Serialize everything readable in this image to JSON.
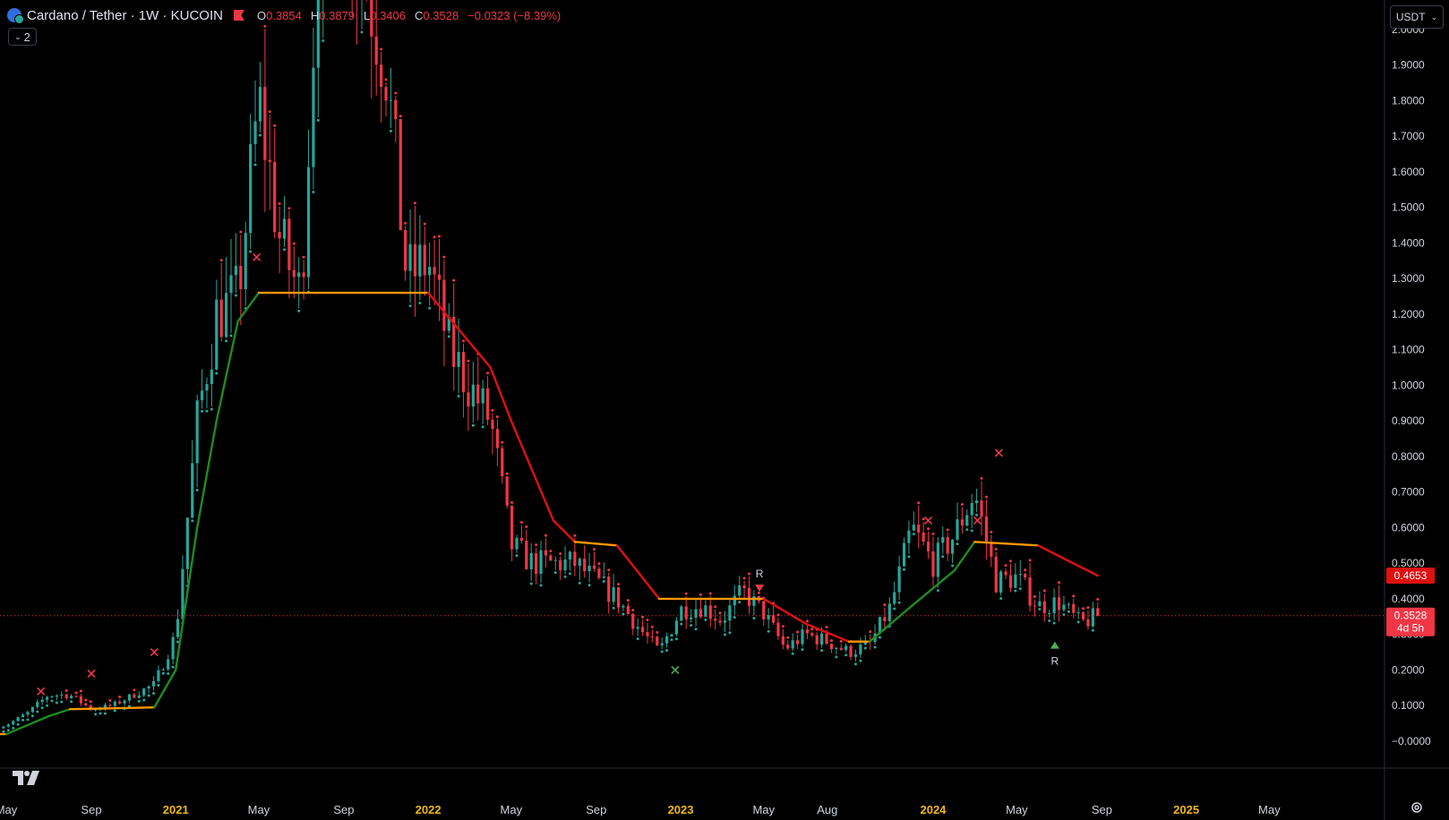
{
  "header": {
    "title": "Cardano / Tether · 1W · KUCOIN",
    "ohlc": [
      {
        "k": "O",
        "v": "0.3854"
      },
      {
        "k": "H",
        "v": "0.3879"
      },
      {
        "k": "L",
        "v": "0.3406"
      },
      {
        "k": "C",
        "v": "0.3528"
      }
    ],
    "change": "−0.0323 (−8.39%)"
  },
  "indicators_toggle": {
    "count": "2",
    "icon": "chevron-down-icon"
  },
  "currency_selector": {
    "value": "USDT",
    "icon": "chevron-down-icon"
  },
  "colors": {
    "up": "#26a69a",
    "down": "#f23645",
    "trend_up": "#1e8c1e",
    "trend_down": "#e01010",
    "trend_neutral": "#ff9800",
    "price_label_bg": "#f23645",
    "axis_text": "#d1d4dc",
    "year_text": "#f0b90b"
  },
  "chart_data": {
    "type": "candlestick",
    "y_axis": {
      "labels": [
        "2.0000",
        "1.9000",
        "1.8000",
        "1.7000",
        "1.6000",
        "1.5000",
        "1.4000",
        "1.3000",
        "1.2000",
        "1.1000",
        "1.0000",
        "0.9000",
        "0.8000",
        "0.7000",
        "0.6000",
        "0.5000",
        "0.4000",
        "0.3000",
        "0.2000",
        "0.1000",
        "−0.0000"
      ],
      "range": [
        -0.015,
        2.0
      ]
    },
    "x_axis": {
      "labels": [
        {
          "t": "May",
          "date": "2020-05",
          "year": false
        },
        {
          "t": "Sep",
          "date": "2020-09",
          "year": false
        },
        {
          "t": "2021",
          "date": "2021-01",
          "year": true
        },
        {
          "t": "May",
          "date": "2021-05",
          "year": false
        },
        {
          "t": "Sep",
          "date": "2021-09",
          "year": false
        },
        {
          "t": "2022",
          "date": "2022-01",
          "year": true
        },
        {
          "t": "May",
          "date": "2022-05",
          "year": false
        },
        {
          "t": "Sep",
          "date": "2022-09",
          "year": false
        },
        {
          "t": "2023",
          "date": "2023-01",
          "year": true
        },
        {
          "t": "May",
          "date": "2023-05",
          "year": false
        },
        {
          "t": "Aug",
          "date": "2023-08",
          "year": false
        },
        {
          "t": "2024",
          "date": "2024-01",
          "year": true
        },
        {
          "t": "May",
          "date": "2024-05",
          "year": false
        },
        {
          "t": "Sep",
          "date": "2024-09",
          "year": false
        },
        {
          "t": "2025",
          "date": "2025-01",
          "year": true
        },
        {
          "t": "May",
          "date": "2025-05",
          "year": false
        }
      ]
    },
    "price_path": [
      [
        "2020-04",
        0.03
      ],
      [
        "2020-05",
        0.045
      ],
      [
        "2020-06",
        0.08
      ],
      [
        "2020-07",
        0.13
      ],
      [
        "2020-08",
        0.13
      ],
      [
        "2020-09",
        0.09
      ],
      [
        "2020-10",
        0.1
      ],
      [
        "2020-11",
        0.13
      ],
      [
        "2020-12",
        0.16
      ],
      [
        "2021-01",
        0.3
      ],
      [
        "2021-02",
        0.9
      ],
      [
        "2021-03",
        1.2
      ],
      [
        "2021-04",
        1.25
      ],
      [
        "2021-05",
        1.8
      ],
      [
        "2021-06",
        1.4
      ],
      [
        "2021-07",
        1.25
      ],
      [
        "2021-08",
        2.5
      ],
      [
        "2021-09",
        2.4
      ],
      [
        "2021-10",
        2.15
      ],
      [
        "2021-11",
        1.9
      ],
      [
        "2021-12",
        1.3
      ],
      [
        "2022-01",
        1.35
      ],
      [
        "2022-02",
        1.1
      ],
      [
        "2022-03",
        1.0
      ],
      [
        "2022-04",
        0.9
      ],
      [
        "2022-05",
        0.55
      ],
      [
        "2022-06",
        0.5
      ],
      [
        "2022-07",
        0.5
      ],
      [
        "2022-08",
        0.5
      ],
      [
        "2022-09",
        0.45
      ],
      [
        "2022-10",
        0.4
      ],
      [
        "2022-11",
        0.32
      ],
      [
        "2022-12",
        0.25
      ],
      [
        "2023-01",
        0.37
      ],
      [
        "2023-02",
        0.38
      ],
      [
        "2023-03",
        0.34
      ],
      [
        "2023-04",
        0.42
      ],
      [
        "2023-05",
        0.36
      ],
      [
        "2023-06",
        0.26
      ],
      [
        "2023-07",
        0.3
      ],
      [
        "2023-08",
        0.28
      ],
      [
        "2023-09",
        0.25
      ],
      [
        "2023-10",
        0.27
      ],
      [
        "2023-11",
        0.38
      ],
      [
        "2023-12",
        0.6
      ],
      [
        "2024-01",
        0.5
      ],
      [
        "2024-02",
        0.58
      ],
      [
        "2024-03",
        0.7
      ],
      [
        "2024-04",
        0.45
      ],
      [
        "2024-05",
        0.46
      ],
      [
        "2024-06",
        0.38
      ],
      [
        "2024-07",
        0.39
      ],
      [
        "2024-08",
        0.33
      ],
      [
        "2024-08-26",
        0.3528
      ]
    ],
    "trend_line": [
      [
        "2020-04",
        0.02,
        "n"
      ],
      [
        "2020-05",
        0.02,
        "u"
      ],
      [
        "2020-07",
        0.07,
        "u"
      ],
      [
        "2020-08",
        0.09,
        "n"
      ],
      [
        "2020-12",
        0.095,
        "u"
      ],
      [
        "2021-01",
        0.2,
        "u"
      ],
      [
        "2021-02",
        0.6,
        "u"
      ],
      [
        "2021-03",
        0.9,
        "u"
      ],
      [
        "2021-04",
        1.18,
        "u"
      ],
      [
        "2021-05",
        1.26,
        "n"
      ],
      [
        "2022-01",
        1.26,
        "d"
      ],
      [
        "2022-04",
        1.05,
        "d"
      ],
      [
        "2022-05",
        0.9,
        "d"
      ],
      [
        "2022-07",
        0.62,
        "d"
      ],
      [
        "2022-08",
        0.56,
        "n"
      ],
      [
        "2022-10",
        0.55,
        "d"
      ],
      [
        "2022-12",
        0.4,
        "n"
      ],
      [
        "2023-05",
        0.4,
        "d"
      ],
      [
        "2023-07",
        0.33,
        "d"
      ],
      [
        "2023-09",
        0.28,
        "n"
      ],
      [
        "2023-10",
        0.28,
        "u"
      ],
      [
        "2023-12",
        0.38,
        "u"
      ],
      [
        "2024-02",
        0.48,
        "u"
      ],
      [
        "2024-03",
        0.56,
        "n"
      ],
      [
        "2024-06",
        0.55,
        "d"
      ],
      [
        "2024-07",
        0.52,
        "d"
      ],
      [
        "2024-08-26",
        0.4653
      ]
    ],
    "markers": [
      {
        "type": "sell-x",
        "date": "2020-06-20",
        "price": 0.14
      },
      {
        "type": "sell-x",
        "date": "2020-09",
        "price": 0.19
      },
      {
        "type": "sell-x",
        "date": "2020-12",
        "price": 0.25
      },
      {
        "type": "sell-x",
        "date": "2021-04-28",
        "price": 1.36
      },
      {
        "type": "buy-x",
        "date": "2022-12-24",
        "price": 0.2
      },
      {
        "type": "sell-triangle",
        "date": "2023-04-25",
        "price": 0.44,
        "label": "R"
      },
      {
        "type": "sell-x",
        "date": "2023-12-25",
        "price": 0.62
      },
      {
        "type": "sell-x",
        "date": "2024-03-05",
        "price": 0.62
      },
      {
        "type": "sell-x",
        "date": "2024-04-05",
        "price": 0.81
      },
      {
        "type": "buy-triangle",
        "date": "2024-06-25",
        "price": 0.26,
        "label": "R"
      }
    ],
    "current_price": {
      "value": "0.3528",
      "countdown": "4d 5h"
    },
    "trend_value": {
      "value": "0.4653"
    }
  }
}
